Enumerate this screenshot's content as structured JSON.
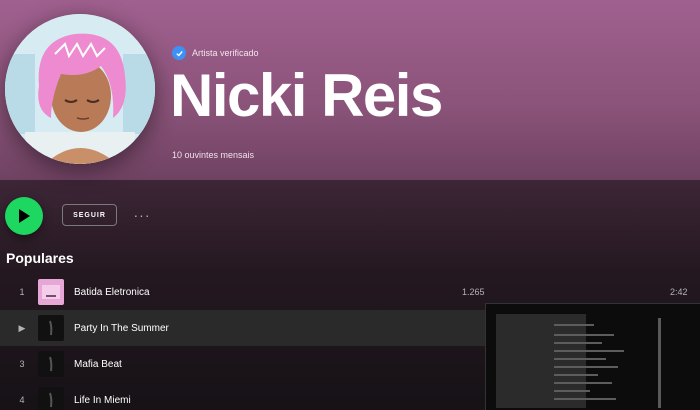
{
  "artist": {
    "verified_label": "Artista verificado",
    "name": "Nicki Reis",
    "listeners": "10 ouvintes mensais"
  },
  "actions": {
    "follow_label": "SEGUIR",
    "more_label": "···"
  },
  "popular": {
    "title": "Populares",
    "tracks": [
      {
        "num": "1",
        "title": "Batida Eletronica",
        "plays": "1.265",
        "duration": "2:42",
        "thumb": "pink"
      },
      {
        "num": "▶",
        "title": "Party In The Summer",
        "plays": "",
        "duration": "",
        "thumb": "dark"
      },
      {
        "num": "3",
        "title": "Mafia Beat",
        "plays": "",
        "duration": "",
        "thumb": "dark"
      },
      {
        "num": "4",
        "title": "Life In Miemi",
        "plays": "",
        "duration": "",
        "thumb": "dark"
      }
    ]
  },
  "colors": {
    "accent": "#1ed760",
    "verified": "#3d91f4",
    "hero_top": "#a0608f"
  },
  "icons": {
    "play": "play-icon",
    "verified": "verified-check-icon"
  }
}
